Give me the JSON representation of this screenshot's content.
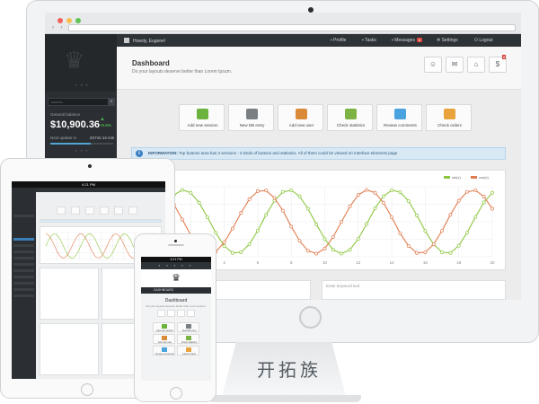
{
  "browser": {
    "nav_arrows": "‹ ›"
  },
  "topbar": {
    "user_greeting": "Howdy, Eugene!",
    "items": [
      {
        "label": "Profile",
        "icon": "user-icon"
      },
      {
        "label": "Tasks",
        "icon": "list-icon"
      },
      {
        "label": "Messages",
        "icon": "chat-icon",
        "badge": "8"
      },
      {
        "label": "Settings",
        "icon": "gear-icon"
      },
      {
        "label": "Logout",
        "icon": "power-icon"
      }
    ]
  },
  "sidebar": {
    "search_placeholder": "search...",
    "balance_label": "General balance",
    "balance_value": "$10,900.36",
    "balance_change": "+0.6%",
    "last_update_label": "Next update in",
    "last_update_value": "23 hrs 14 min"
  },
  "header": {
    "title": "Dashboard",
    "subtitle": "Do your layouts deserve better than Lorem Ipsum.",
    "icon_buttons": [
      "users-icon",
      "chat-icon",
      "bank-icon",
      "money-icon"
    ],
    "notification_badge": "8"
  },
  "quick_actions": [
    {
      "label": "Add new session",
      "icon": "plus-icon",
      "color": "#6cb33e"
    },
    {
      "label": "New DB entry",
      "icon": "database-icon",
      "color": "#7a7f84"
    },
    {
      "label": "Add new user",
      "icon": "user-add-icon",
      "color": "#d98b3a"
    },
    {
      "label": "Check statistics",
      "icon": "bar-chart-icon",
      "color": "#7cb342"
    },
    {
      "label": "Review comments",
      "icon": "comment-icon",
      "color": "#4aa3df"
    },
    {
      "label": "Check orders",
      "icon": "clipboard-icon",
      "color": "#e8a33d"
    }
  ],
  "info_bar": {
    "strong": "INFORMATION:",
    "text": " Top buttons area has 3 versions - 2 kinds of buttons and statistics. All of them could be viewed on Interface elements page"
  },
  "lower_right": {
    "placeholder": "Enter keyword text"
  },
  "chart_data": {
    "type": "line",
    "x": [
      0,
      0.5,
      1,
      1.5,
      2,
      2.5,
      3,
      3.5,
      4,
      4.5,
      5,
      5.5,
      6,
      6.5,
      7,
      7.5,
      8,
      8.5,
      9,
      9.5,
      10,
      10.5,
      11,
      11.5,
      12,
      12.5,
      13,
      13.5,
      14,
      14.5,
      15,
      15.5,
      16,
      16.5,
      17,
      17.5,
      18,
      18.5,
      19,
      19.5,
      20
    ],
    "x_ticks": [
      2,
      4,
      6,
      8,
      10,
      12,
      14,
      16,
      18,
      20
    ],
    "xlim": [
      0,
      20
    ],
    "ylim": [
      -1.1,
      1.1
    ],
    "grid": true,
    "legend_position": "top-right",
    "series": [
      {
        "name": "sin(x)",
        "color": "#8dc63f",
        "values": [
          0,
          0.48,
          0.84,
          1,
          0.91,
          0.6,
          0.14,
          -0.35,
          -0.76,
          -0.98,
          -0.96,
          -0.71,
          -0.28,
          0.22,
          0.66,
          0.94,
          0.99,
          0.8,
          0.41,
          -0.08,
          -0.54,
          -0.88,
          -1,
          -0.88,
          -0.54,
          -0.07,
          0.42,
          0.8,
          0.99,
          0.93,
          0.65,
          0.2,
          -0.29,
          -0.71,
          -0.96,
          -0.98,
          -0.75,
          -0.34,
          0.15,
          0.61,
          0.91
        ]
      },
      {
        "name": "cos(x)",
        "color": "#e07b4f",
        "values": [
          1,
          0.88,
          0.54,
          0.07,
          -0.42,
          -0.8,
          -0.99,
          -0.94,
          -0.65,
          -0.21,
          0.28,
          0.71,
          0.96,
          0.98,
          0.75,
          0.35,
          -0.15,
          -0.6,
          -0.91,
          -1,
          -0.84,
          -0.48,
          0,
          0.48,
          0.84,
          1,
          0.91,
          0.6,
          0.14,
          -0.36,
          -0.76,
          -0.98,
          -0.96,
          -0.71,
          -0.28,
          0.22,
          0.66,
          0.94,
          0.99,
          0.79,
          0.41
        ]
      }
    ]
  },
  "ipad": {
    "status_time": "4:21 PM"
  },
  "iphone": {
    "status_time": "4:21 PM",
    "menu_label": "DASHBOARD",
    "dash_title": "Dashboard",
    "dash_sub": "Do your layouts deserve better than Lorem Ipsum.",
    "buttons": [
      {
        "label": "Add new session",
        "color": "#6cb33e"
      },
      {
        "label": "New DB entry",
        "color": "#7a7f84"
      },
      {
        "label": "Add new user",
        "color": "#d98b3a"
      },
      {
        "label": "Check statistics",
        "color": "#7cb342"
      },
      {
        "label": "Review comments",
        "color": "#4aa3df"
      },
      {
        "label": "Check orders",
        "color": "#e8a33d"
      }
    ]
  },
  "watermark": "开拓族"
}
